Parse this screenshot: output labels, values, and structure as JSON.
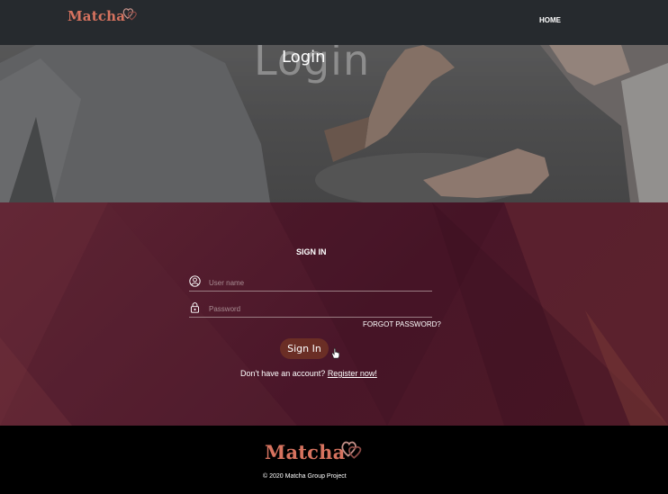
{
  "header": {
    "brand": "Matcha",
    "nav_home": "HOME"
  },
  "hero": {
    "background_title": "Login",
    "title": "Login"
  },
  "login": {
    "heading": "SIGN IN",
    "username": {
      "placeholder": "User name",
      "value": ""
    },
    "password": {
      "placeholder": "Password",
      "value": ""
    },
    "forgot_password": "FORGOT PASSWORD?",
    "signin_button": "Sign In",
    "register_prompt": "Don't have an account?",
    "register_link": "Register now!"
  },
  "footer": {
    "brand": "Matcha",
    "copyright": "© 2020 Matcha Group Project"
  },
  "colors": {
    "topbar": "#262a2e",
    "brand": "#d7735f",
    "panel": "#4a1629",
    "button": "#6b2e25",
    "footer": "#000000"
  },
  "icons": [
    "hearts-logo-icon",
    "user-icon",
    "lock-icon",
    "hand-cursor-icon"
  ]
}
